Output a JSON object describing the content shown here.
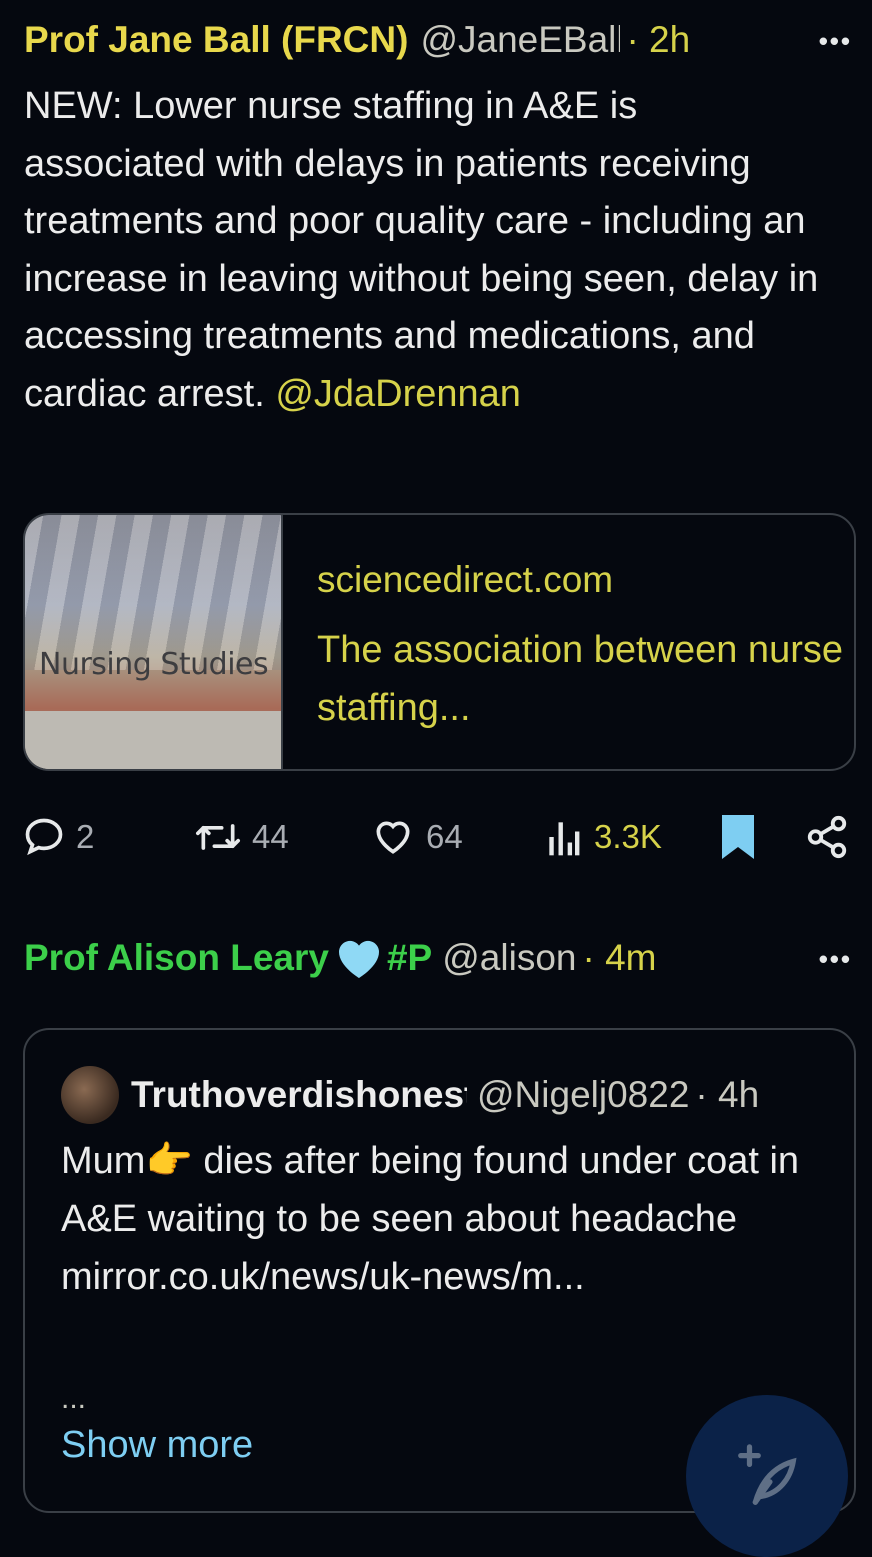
{
  "tweet1": {
    "display_name": "Prof Jane Ball (FRCN)",
    "handle": "@JaneEBall",
    "time": "· 2h",
    "more": "•••",
    "text": "NEW: Lower nurse staffing in A&E is associated with delays in patients receiving treatments and poor quality care - including an increase in leaving without being seen, delay in accessing treatments and medications, and cardiac arrest. ",
    "mention": "@JdaDrennan",
    "link_card": {
      "journal": "Nursing Studies",
      "domain": "sciencedirect.com",
      "title": "The association between nurse staffing..."
    },
    "actions": {
      "replies": "2",
      "retweets": "44",
      "likes": "64",
      "views": "3.3K"
    },
    "colors": {
      "accent": "#d6d24a",
      "bookmark": "#7ecef2"
    }
  },
  "tweet2": {
    "display_name": "Prof Alison Leary",
    "emoji": "🩵",
    "display_name_suffix": "#P",
    "handle": "@alison",
    "time": "· 4m",
    "more": "•••",
    "quote": {
      "name": "Truthoverdishonesty",
      "handle": "@Nigelj0822",
      "time": "· 4h",
      "text": "Mum👉 dies after being found under coat in A&E waiting to be seen about headache mirror.co.uk/news/uk-news/m...",
      "ellipsis": "...",
      "show_more": "Show more"
    }
  },
  "fab": {
    "icon": "compose-icon"
  }
}
